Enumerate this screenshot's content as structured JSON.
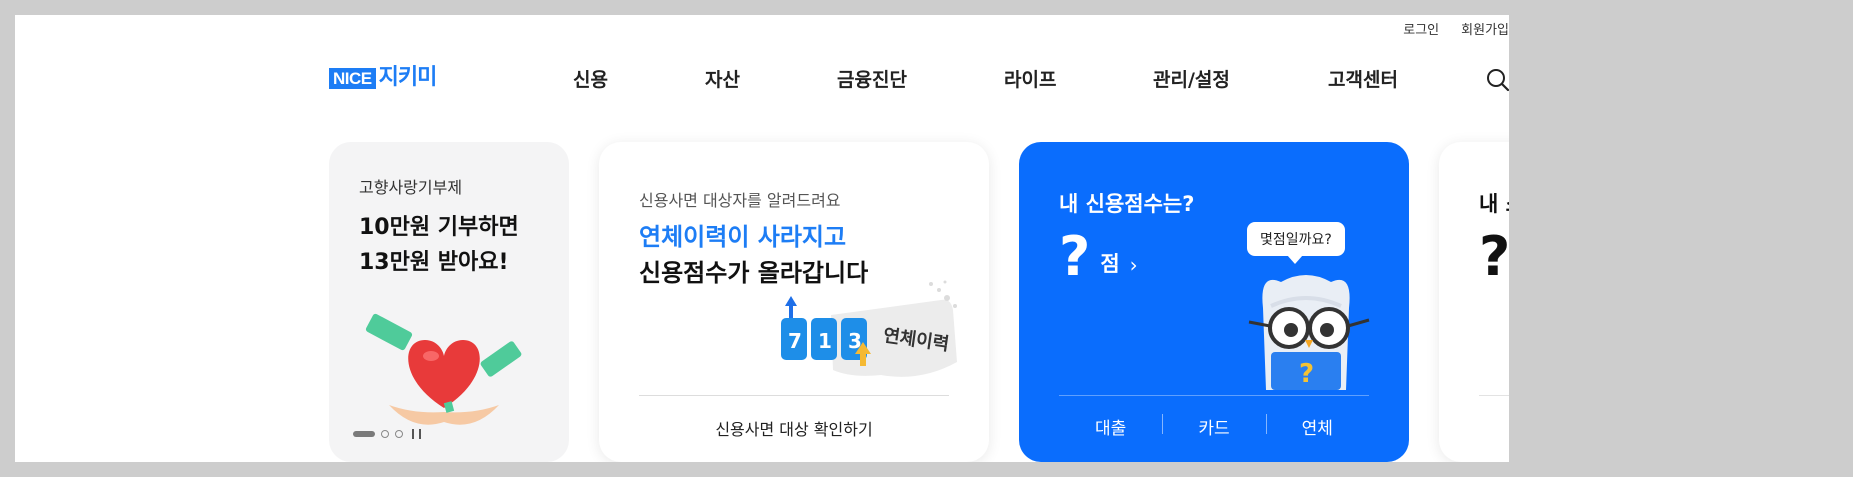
{
  "header": {
    "util_links": [
      "로그인",
      "회원가입"
    ],
    "logo": {
      "badge": "NICE",
      "text": "지키미",
      "color": "#1d7df5"
    },
    "menu": [
      "신용",
      "자산",
      "금융진단",
      "라이프",
      "관리/설정",
      "고객센터"
    ],
    "search_icon": "search-icon"
  },
  "cards": {
    "donation": {
      "subtitle": "고향사랑기부제",
      "title_line1": "10만원 기부하면",
      "title_line2": "13만원 받아요!",
      "image_icon": "heart-money-hands-illustration",
      "pager": {
        "active_index": 0,
        "total": 3,
        "pause_icon": "pause-icon"
      }
    },
    "delinquency": {
      "subtitle": "신용사면 대상자를 알려드려요",
      "title_highlight": "연체이력이 사라지고",
      "title_rest": "신용점수가 올라갑니다",
      "illustration_digits": [
        "7",
        "1",
        "3"
      ],
      "illustration_label": "연체이력",
      "cta": "신용사면 대상 확인하기",
      "accent": "#1d7df5"
    },
    "credit_score": {
      "title": "내 신용점수는?",
      "score": "?",
      "unit": "점",
      "bubble": "몇점일까요?",
      "tabs": [
        "대출",
        "카드",
        "연체"
      ],
      "background": "#0a6dfd"
    },
    "partial": {
      "title": "내 소",
      "score": "?"
    }
  }
}
